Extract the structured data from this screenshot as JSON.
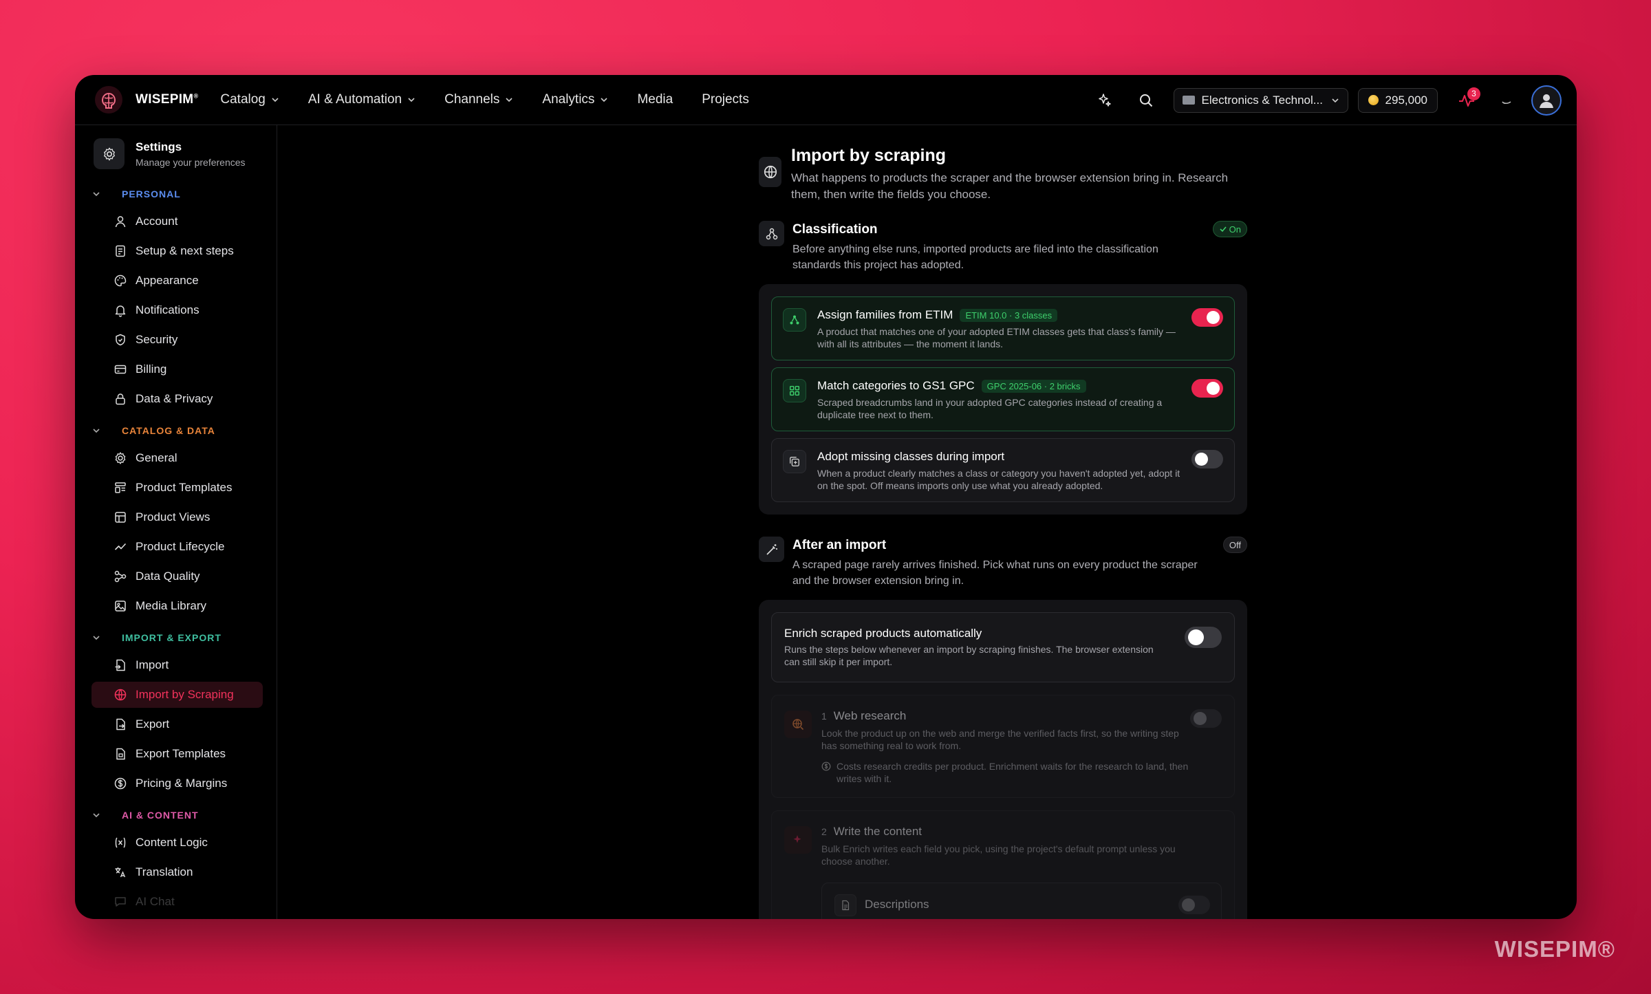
{
  "brand": {
    "name": "WISEPIM",
    "mark": "®"
  },
  "nav": [
    "Catalog",
    "AI & Automation",
    "Channels",
    "Analytics",
    "Media",
    "Projects"
  ],
  "project": {
    "name": "Electronics & Technol..."
  },
  "credits": "295,000",
  "notifications": {
    "count": "3"
  },
  "settings": {
    "title": "Settings",
    "subtitle": "Manage your preferences"
  },
  "sections": {
    "personal": "PERSONAL",
    "catalog": "CATALOG & DATA",
    "import": "IMPORT & EXPORT",
    "ai": "AI & CONTENT"
  },
  "colors": {
    "personal": "#5b8def",
    "catalog": "#e8843a",
    "import": "#3fbfa0",
    "ai": "#e05aa8",
    "accent": "#e8244f"
  },
  "personal_items": [
    "Account",
    "Setup & next steps",
    "Appearance",
    "Notifications",
    "Security",
    "Billing",
    "Data & Privacy"
  ],
  "catalog_items": [
    "General",
    "Product Templates",
    "Product Views",
    "Product Lifecycle",
    "Data Quality",
    "Media Library"
  ],
  "import_items": [
    "Import",
    "Import by Scraping",
    "Export",
    "Export Templates",
    "Pricing & Margins"
  ],
  "ai_items": [
    "Content Logic",
    "Translation",
    "AI Chat"
  ],
  "page": {
    "title": "Import by scraping",
    "description": "What happens to products the scraper and the browser extension bring in. Research them, then write the fields you choose."
  },
  "classification": {
    "title": "Classification",
    "status": "On",
    "description": "Before anything else runs, imported products are filed into the classification standards this project has adopted.",
    "cards": [
      {
        "title": "Assign families from ETIM",
        "tag": "ETIM 10.0 · 3 classes",
        "description": "A product that matches one of your adopted ETIM classes gets that class's family — with all its attributes — the moment it lands.",
        "on": true
      },
      {
        "title": "Match categories to GS1 GPC",
        "tag": "GPC 2025-06 · 2 bricks",
        "description": "Scraped breadcrumbs land in your adopted GPC categories instead of creating a duplicate tree next to them.",
        "on": true
      },
      {
        "title": "Adopt missing classes during import",
        "tag": "",
        "description": "When a product clearly matches a class or category you haven't adopted yet, adopt it on the spot. Off means imports only use what you already adopted.",
        "on": false
      }
    ]
  },
  "after_import": {
    "title": "After an import",
    "status": "Off",
    "description": "A scraped page rarely arrives finished. Pick what runs on every product the scraper and the browser extension bring in.",
    "enrich": {
      "title": "Enrich scraped products automatically",
      "description": "Runs the steps below whenever an import by scraping finishes. The browser extension can still skip it per import."
    },
    "steps": [
      {
        "num": "1",
        "title": "Web research",
        "description": "Look the product up on the web and merge the verified facts first, so the writing step has something real to work from.",
        "note": "Costs research credits per product. Enrichment waits for the research to land, then writes with it."
      },
      {
        "num": "2",
        "title": "Write the content",
        "description": "Bulk Enrich writes each field you pick, using the project's default prompt unless you choose another.",
        "field": "Descriptions"
      }
    ]
  },
  "watermark": "WISEPIM®"
}
